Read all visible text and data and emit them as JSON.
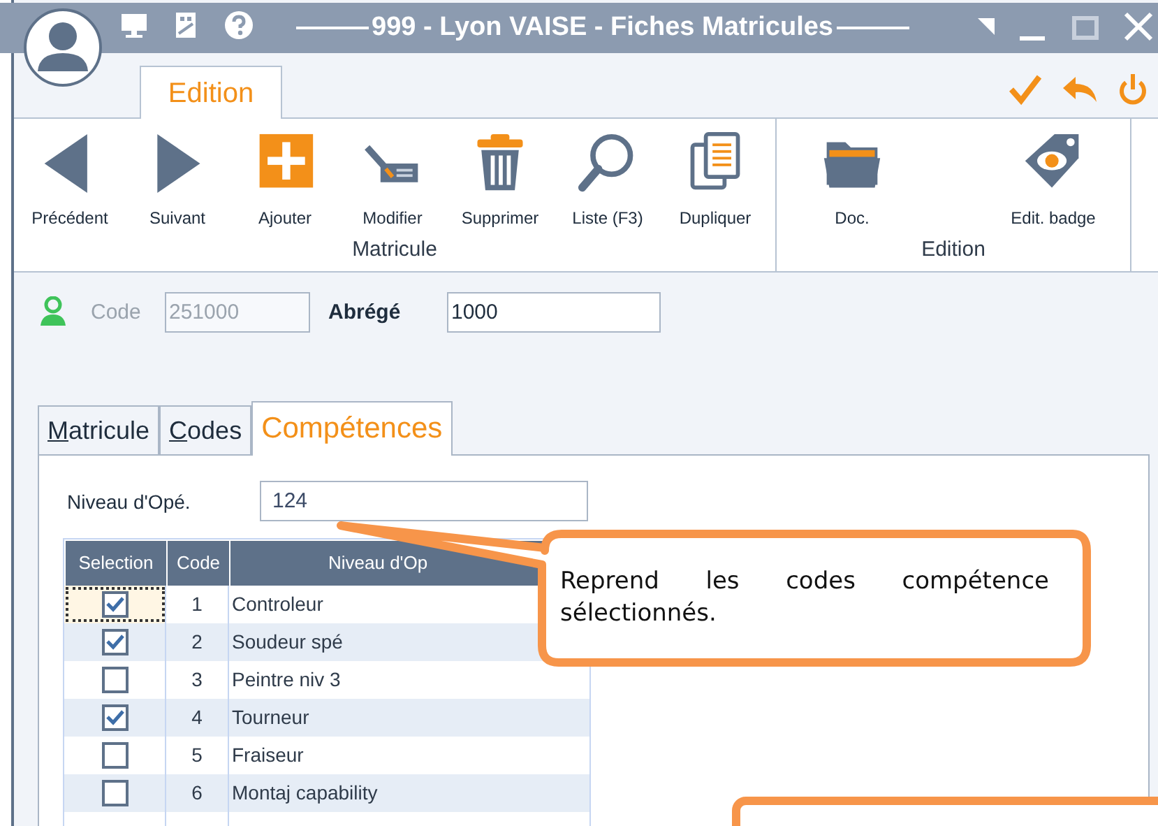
{
  "window": {
    "title": "999 - Lyon VAISE - Fiches Matricules"
  },
  "ribbon_tabs": [
    {
      "label": "Edition",
      "selected": true
    }
  ],
  "ribbon_groups": [
    {
      "label": "Matricule",
      "buttons": [
        {
          "label": "Précédent",
          "kind": "prev"
        },
        {
          "label": "Suivant",
          "kind": "next"
        },
        {
          "label": "Ajouter",
          "kind": "add"
        },
        {
          "label": "Modifier",
          "kind": "edit"
        },
        {
          "label": "Supprimer",
          "kind": "delete"
        },
        {
          "label": "Liste (F3)",
          "kind": "search"
        },
        {
          "label": "Dupliquer",
          "kind": "copy"
        }
      ]
    },
    {
      "label": "Edition",
      "buttons": [
        {
          "label": "Doc.",
          "kind": "folder"
        },
        {
          "label": "Edit. badge",
          "kind": "badge"
        }
      ]
    }
  ],
  "form": {
    "code": {
      "label": "Code",
      "value": "251000",
      "disabled": true
    },
    "abrege": {
      "label": "Abrégé",
      "value": "1000",
      "disabled": false
    }
  },
  "tabs": [
    {
      "label": "Matricule",
      "selected": false,
      "mnemonic": true
    },
    {
      "label": "Codes",
      "selected": false,
      "mnemonic": true
    },
    {
      "label": "Compétences",
      "selected": true,
      "mnemonic": false
    }
  ],
  "niveau": {
    "label": "Niveau d'Opé.",
    "value": "124"
  },
  "table": {
    "columns": [
      "Selection",
      "Code",
      "Niveau d'Op"
    ],
    "rows": [
      {
        "checked": true,
        "focused": true,
        "code": "1",
        "name": "Controleur"
      },
      {
        "checked": true,
        "focused": false,
        "code": "2",
        "name": "Soudeur spé"
      },
      {
        "checked": false,
        "focused": false,
        "code": "3",
        "name": "Peintre niv 3"
      },
      {
        "checked": true,
        "focused": false,
        "code": "4",
        "name": "Tourneur"
      },
      {
        "checked": false,
        "focused": false,
        "code": "5",
        "name": "Fraiseur"
      },
      {
        "checked": false,
        "focused": false,
        "code": "6",
        "name": "Montaj capability"
      }
    ]
  },
  "callouts": [
    {
      "kind": "text",
      "text": "Reprend les codes compétence sélectionnés."
    },
    {
      "kind": "blank"
    }
  ]
}
